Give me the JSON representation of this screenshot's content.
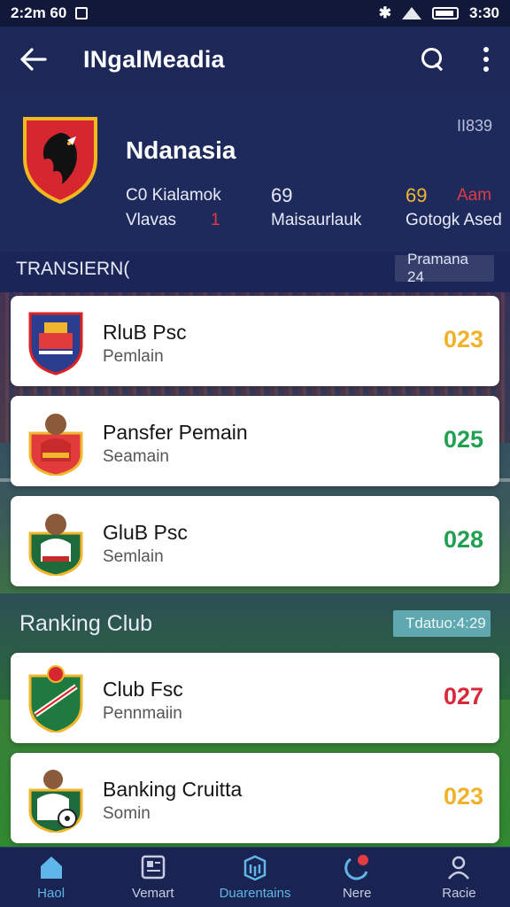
{
  "status_bar": {
    "time": "2:2m 60",
    "right_text": "3:30"
  },
  "app_bar": {
    "title": "INgalMeadia"
  },
  "club_header": {
    "name": "Ndanasia",
    "corner_label": "II839",
    "stats": {
      "row1_left": "C0 Kialamok",
      "row1_mid": "69",
      "row1_right_num": "69",
      "row1_right_text": "Aam",
      "row2_left": "Vlavas",
      "row2_left_num": "1",
      "row2_mid": "Maisaurlauk",
      "row2_right": "Gotogk Ased"
    }
  },
  "transfer_section": {
    "title": "TRANSIERN(",
    "pill": "Pramana 24"
  },
  "ranking_section": {
    "title": "Ranking Club",
    "pill": "Tdatuo:4:29"
  },
  "cards": [
    {
      "title": "RluB Psc",
      "subtitle": "Pemlain",
      "score": "023",
      "score_color": "#f0b22a"
    },
    {
      "title": "Pansfer Pemain",
      "subtitle": "Seamain",
      "score": "025",
      "score_color": "#22a052"
    },
    {
      "title": "GluB Psc",
      "subtitle": "Semlain",
      "score": "028",
      "score_color": "#22a052"
    },
    {
      "title": "Club Fsc",
      "subtitle": "Pennmaiin",
      "score": "027",
      "score_color": "#d8283a"
    },
    {
      "title": "Banking Cruitta",
      "subtitle": "Somin",
      "score": "023",
      "score_color": "#f0b22a"
    }
  ],
  "bottom_nav": [
    {
      "label": "Haol",
      "icon": "home-icon",
      "active": true
    },
    {
      "label": "Vemart",
      "icon": "news-icon",
      "active": false
    },
    {
      "label": "Duarentains",
      "icon": "box-icon",
      "active": true
    },
    {
      "label": "Nere",
      "icon": "notification-icon",
      "active": false
    },
    {
      "label": "Racie",
      "icon": "profile-icon",
      "active": false
    }
  ],
  "colors": {
    "primary_bg": "#1b2557",
    "accent_blue": "#5fb6e8",
    "accent_teal": "#5fa8b0",
    "score_yellow": "#f0b22a",
    "score_green": "#22a052",
    "score_red": "#d8283a"
  }
}
